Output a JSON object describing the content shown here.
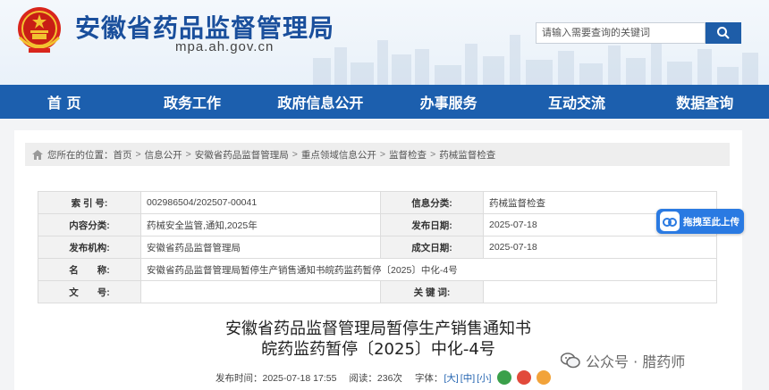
{
  "header": {
    "site_title": "安徽省药品监督管理局",
    "site_domain": "mpa.ah.gov.cn",
    "search_placeholder": "请输入需要查询的关键词"
  },
  "nav": {
    "items": [
      "首 页",
      "政务工作",
      "政府信息公开",
      "办事服务",
      "互动交流",
      "数据查询"
    ]
  },
  "breadcrumb": {
    "prefix": "您所在的位置：",
    "items": [
      "首页",
      "信息公开",
      "安徽省药品监督管理局",
      "重点领域信息公开",
      "监督检查",
      "药械监督检查"
    ],
    "separator": ">"
  },
  "info_table": {
    "index_label": "索 引 号:",
    "index_value": "002986504/202507-00041",
    "category_label": "信息分类:",
    "category_value": "药械监督检查",
    "content_label": "内容分类:",
    "content_value": "药械安全监管,通知,2025年",
    "pubdate_label": "发布日期:",
    "pubdate_value": "2025-07-18",
    "org_label": "发布机构:",
    "org_value": "安徽省药品监督管理局",
    "formed_label": "成文日期:",
    "formed_value": "2025-07-18",
    "name_label": "名　　称:",
    "name_value": "安徽省药品监督管理局暂停生产销售通知书皖药监药暂停〔2025〕中化-4号",
    "docno_label": "文　　号:",
    "docno_value": "",
    "keywords_label": "关 键 词:",
    "keywords_value": ""
  },
  "document": {
    "title_line1": "安徽省药品监督管理局暂停生产销售通知书",
    "title_line2": "皖药监药暂停〔2025〕中化-4号",
    "publish_time": "发布时间：2025-07-18 17:55",
    "views": "阅读：236次",
    "font_label": "字体：",
    "font_large": "[大]",
    "font_medium": "[中]",
    "font_small": "[小]"
  },
  "upload_button": {
    "label": "拖拽至此上传"
  },
  "watermark": {
    "text": "公众号 · 腊药师"
  },
  "colors": {
    "brand_blue": "#1c5fae",
    "title_blue": "#1a4f9c",
    "upload_blue": "#2a7ae2"
  }
}
